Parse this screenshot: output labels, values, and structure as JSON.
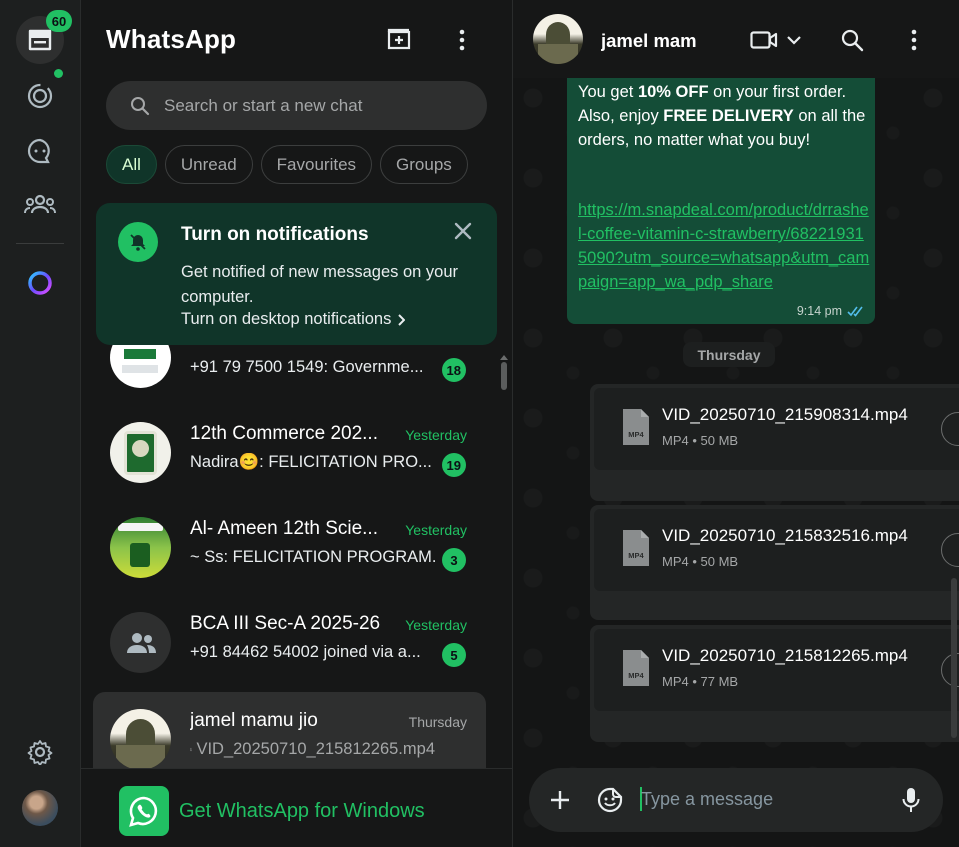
{
  "rail": {
    "chats_badge": "60",
    "items": [
      "chats-icon",
      "status-icon",
      "channels-icon",
      "communities-icon",
      "meta-ai-icon",
      "settings-icon",
      "profile-avatar"
    ]
  },
  "list": {
    "title": "WhatsApp",
    "search_placeholder": "Search or start a new chat",
    "filters": [
      "All",
      "Unread",
      "Favourites",
      "Groups"
    ],
    "notification": {
      "title": "Turn on notifications",
      "body": "Get notified of new messages on your computer.",
      "link": "Turn on desktop notifications"
    },
    "chats": [
      {
        "name": "",
        "time": "",
        "message": "+91 79 7500 1549: Governme...",
        "unread": "18"
      },
      {
        "name": "12th Commerce 202...",
        "time": "Yesterday",
        "message": "Nadira😊: FELICITATION PRO...",
        "unread": "19"
      },
      {
        "name": "Al- Ameen 12th Scie...",
        "time": "Yesterday",
        "message": "~ Ss: FELICITATION PROGRAM...",
        "unread": "3"
      },
      {
        "name": "BCA III Sec-A 2025-26",
        "time": "Yesterday",
        "message": "+91 84462 54002 joined via a...",
        "unread": "5"
      },
      {
        "name": "jamel mamu jio",
        "time": "Thursday",
        "message": "VID_20250710_215812265.mp4",
        "unread": ""
      }
    ],
    "get_app": "Get WhatsApp for Windows"
  },
  "conversation": {
    "contact_name": "jamel mam",
    "message": {
      "text_pre": "You get ",
      "bold1": "10% OFF",
      "text_mid1": " on your first order. Also, enjoy ",
      "bold2": "FREE DELIVERY",
      "text_post": " on all the orders, no matter what you buy!",
      "link": "https://m.snapdeal.com/product/drrashel-coffee-vitamin-c-strawberry/682219315090?utm_source=whatsapp&utm_campaign=app_wa_pdp_share",
      "time": "9:14 pm"
    },
    "day_separator": "Thursday",
    "files": [
      {
        "name": "VID_20250710_215908314.mp4",
        "meta": "MP4 • 50 MB",
        "type": "MP4"
      },
      {
        "name": "VID_20250710_215832516.mp4",
        "meta": "MP4 • 50 MB",
        "type": "MP4"
      },
      {
        "name": "VID_20250710_215812265.mp4",
        "meta": "MP4 • 77 MB",
        "type": "MP4"
      }
    ],
    "compose_placeholder": "Type a message"
  },
  "colors": {
    "accent": "#21c063",
    "panel": "#161717",
    "bubble_out": "#144d37",
    "notif_bg": "#103529"
  }
}
